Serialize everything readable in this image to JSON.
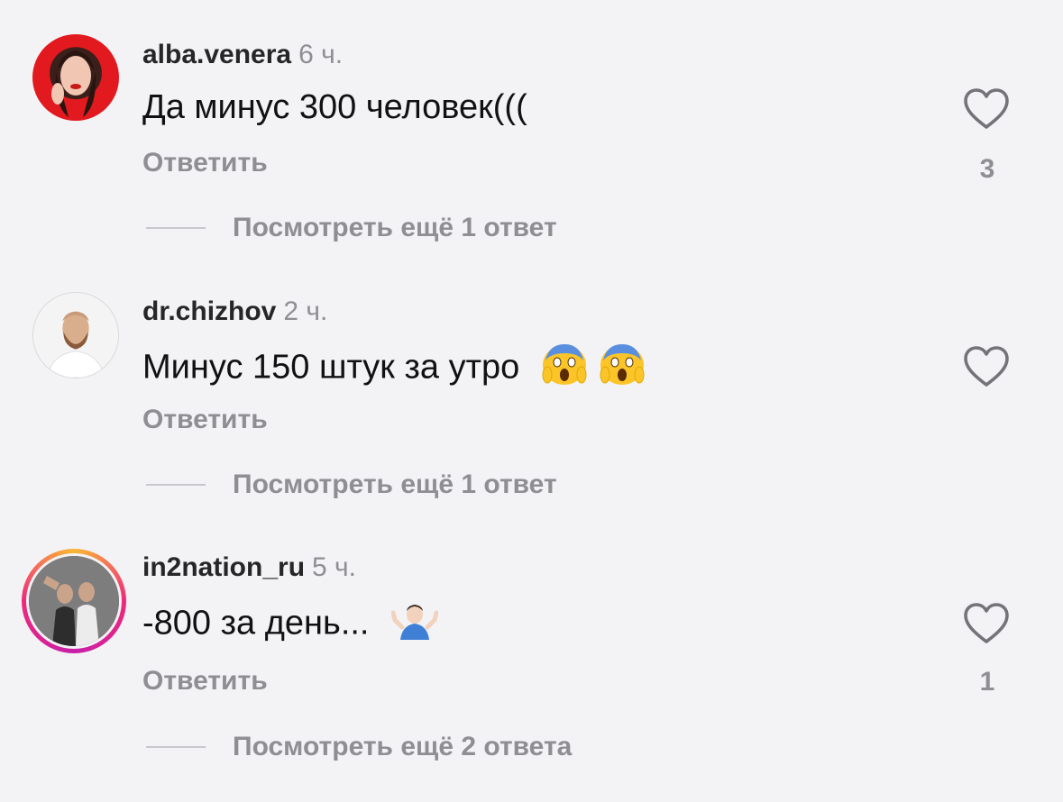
{
  "comments": [
    {
      "username": "alba.venera",
      "time": "6 ч.",
      "text": "Да минус 300 человек(((",
      "reply_label": "Ответить",
      "likes": "3",
      "replies_label": "Посмотреть ещё 1 ответ",
      "avatar_colors": [
        "#e0141e",
        "#f04a3a"
      ]
    },
    {
      "username": "dr.chizhov",
      "time": "2 ч.",
      "text": "Минус 150 штук за утро",
      "emojis": [
        "scream-emoji",
        "scream-emoji"
      ],
      "reply_label": "Ответить",
      "likes": "",
      "replies_label": "Посмотреть ещё 1 ответ",
      "avatar_colors": [
        "#f2f2f2",
        "#d9c1a5"
      ]
    },
    {
      "username": "in2nation_ru",
      "time": "5 ч.",
      "text": "-800 за день...",
      "emojis": [
        "shrug-emoji"
      ],
      "reply_label": "Ответить",
      "likes": "1",
      "replies_label": "Посмотреть ещё 2 ответа",
      "avatar_colors": [
        "#6f6f6f",
        "#2b2b2b"
      ],
      "story_ring": true
    }
  ],
  "icons": {
    "like": "heart-outline-icon"
  },
  "colors": {
    "background": "#f3f3f6",
    "secondary_text": "#8e8e93",
    "primary_text": "#111111"
  }
}
